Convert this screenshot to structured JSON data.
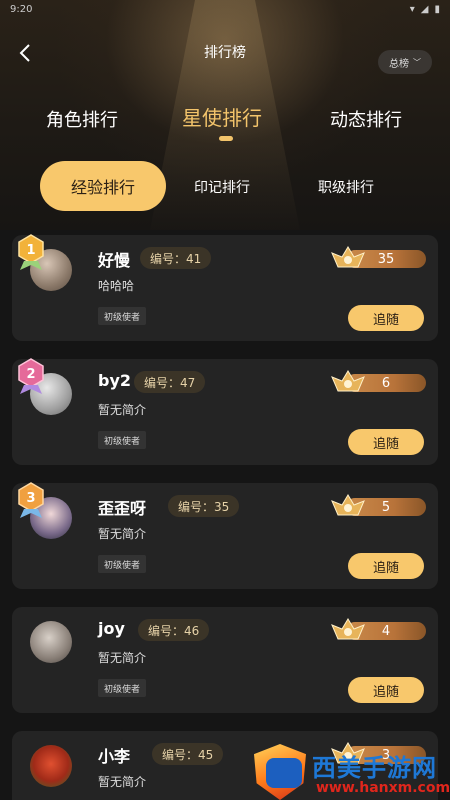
{
  "status": {
    "time": "9:20"
  },
  "header": {
    "title": "排行榜",
    "total_label": "总榜"
  },
  "main_tabs": [
    {
      "label": "角色排行"
    },
    {
      "label": "星使排行"
    },
    {
      "label": "动态排行"
    }
  ],
  "sub_tabs": [
    {
      "label": "经验排行"
    },
    {
      "label": "印记排行"
    },
    {
      "label": "职级排行"
    }
  ],
  "colors": {
    "accent": "#f8c86c",
    "background": "#151515",
    "card": "#242424"
  },
  "users": [
    {
      "rank": "1",
      "name": "好慢",
      "number": "编号：41",
      "bio": "哈哈哈",
      "tag": "初级使者",
      "level": "35",
      "follow": "追随"
    },
    {
      "rank": "2",
      "name": "by2",
      "number": "编号：47",
      "bio": "暂无简介",
      "tag": "初级使者",
      "level": "6",
      "follow": "追随"
    },
    {
      "rank": "3",
      "name": "歪歪呀",
      "number": "编号：35",
      "bio": "暂无简介",
      "tag": "初级使者",
      "level": "5",
      "follow": "追随"
    },
    {
      "rank": "",
      "name": "joy",
      "number": "编号：46",
      "bio": "暂无简介",
      "tag": "初级使者",
      "level": "4",
      "follow": "追随"
    },
    {
      "rank": "",
      "name": "小李",
      "number": "编号：45",
      "bio": "暂无简介",
      "tag": "",
      "level": "3",
      "follow": ""
    }
  ],
  "watermark": {
    "text": "西美手游网",
    "url": "www.hanxm.com"
  }
}
